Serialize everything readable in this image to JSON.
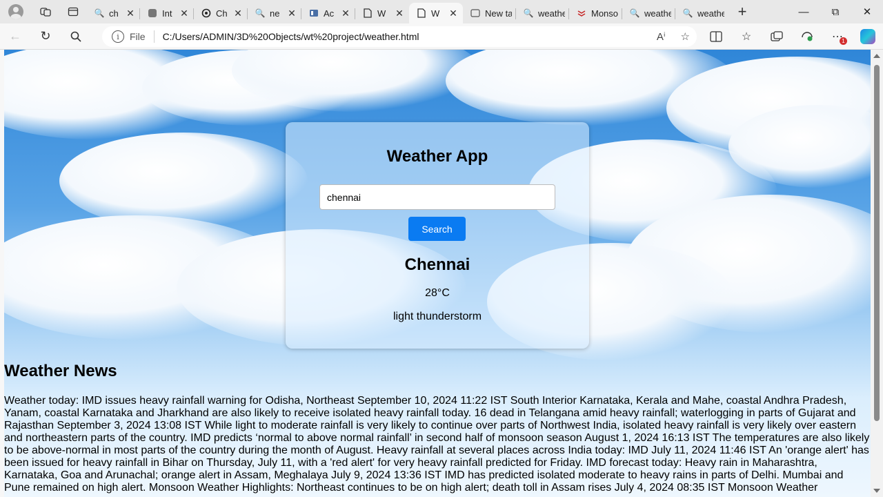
{
  "browser": {
    "tabs": [
      {
        "icon": "search-icon",
        "title": "ch"
      },
      {
        "icon": "page-icon",
        "title": "Int"
      },
      {
        "icon": "openai-icon",
        "title": "Ch"
      },
      {
        "icon": "search-icon",
        "title": "ne"
      },
      {
        "icon": "book-icon",
        "title": "Ac"
      },
      {
        "icon": "page-icon",
        "title": "W"
      },
      {
        "icon": "page-icon",
        "title": "W",
        "active": true
      },
      {
        "icon": "newtab-icon",
        "title": "New ta"
      },
      {
        "icon": "search-icon",
        "title": "weathe"
      },
      {
        "icon": "monsoon-icon",
        "title": "Monso"
      },
      {
        "icon": "search-icon",
        "title": "weathe"
      },
      {
        "icon": "search-icon",
        "title": "weathe"
      }
    ],
    "file_label": "File",
    "url": "C:/Users/ADMIN/3D%20Objects/wt%20project/weather.html",
    "notification_count": "1"
  },
  "app": {
    "title": "Weather App",
    "search_value": "chennai",
    "search_button": "Search",
    "city": "Chennai",
    "temperature": "28°C",
    "description": "light thunderstorm"
  },
  "news": {
    "heading": "Weather News",
    "text": "Weather today: IMD issues heavy rainfall warning for Odisha, Northeast September 10, 2024 11:22 IST South Interior Karnataka, Kerala and Mahe, coastal Andhra Pradesh, Yanam, coastal Karnataka and Jharkhand are also likely to receive isolated heavy rainfall today. 16 dead in Telangana amid heavy rainfall; waterlogging in parts of Gujarat and Rajasthan September 3, 2024 13:08 IST While light to moderate rainfall is very likely to continue over parts of Northwest India, isolated heavy rainfall is very likely over eastern and northeastern parts of the country. IMD predicts ‘normal to above normal rainfall’ in second half of monsoon season August 1, 2024 16:13 IST The temperatures are also likely to be above-normal in most parts of the country during the month of August. Heavy rainfall at several places across India today: IMD July 11, 2024 11:46 IST An 'orange alert' has been issued for heavy rainfall in Bihar on Thursday, July 11, with a 'red alert' for very heavy rainfall predicted for Friday. IMD forecast today: Heavy rain in Maharashtra, Karnataka, Goa and Arunachal; orange alert in Assam, Meghalaya July 9, 2024 13:36 IST IMD has predicted isolated moderate to heavy rains in parts of Delhi. Mumbai and Pune remained on high alert. Monsoon Weather Highlights: Northeast continues to be on high alert; death toll in Assam rises July 4, 2024 08:35 IST Monsoon Weather"
  }
}
